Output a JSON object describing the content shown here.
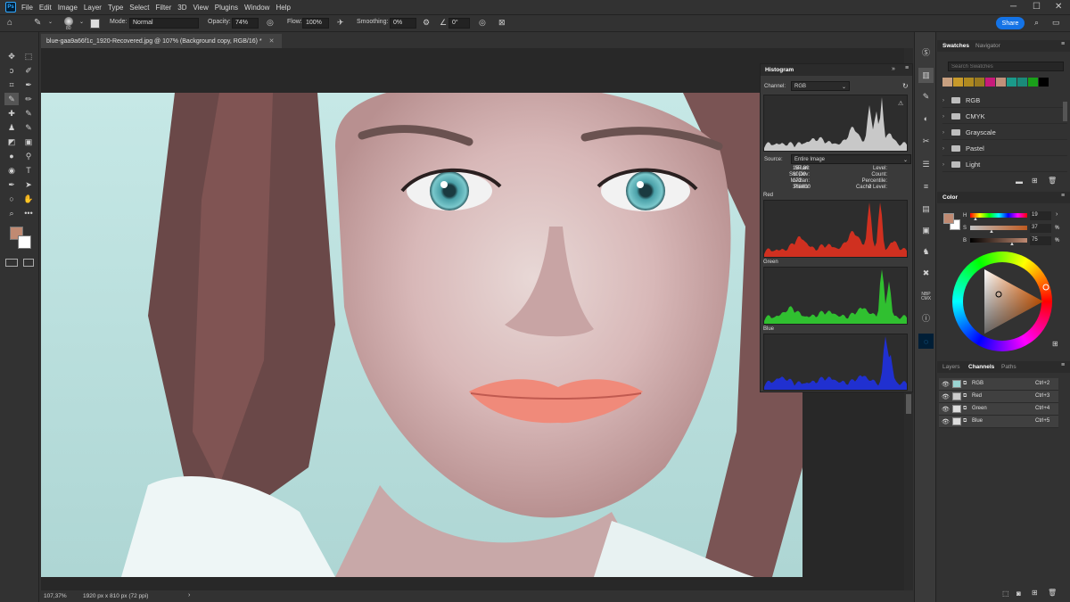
{
  "menu": {
    "app_icon": "Ps",
    "items": [
      "File",
      "Edit",
      "Image",
      "Layer",
      "Type",
      "Select",
      "Filter",
      "3D",
      "View",
      "Plugins",
      "Window",
      "Help"
    ]
  },
  "options": {
    "brush_size": "80",
    "mode_label": "Mode:",
    "mode_value": "Normal",
    "opacity_label": "Opacity:",
    "opacity_value": "74%",
    "flow_label": "Flow:",
    "flow_value": "100%",
    "smoothing_label": "Smoothing:",
    "smoothing_value": "0%",
    "angle_value": "0°",
    "share_label": "Share"
  },
  "document": {
    "tab_title": "blue-gaa9a66f1c_1920-Recovered.jpg @ 107% (Background copy, RGB/16) *",
    "zoom": "107,37%",
    "dimensions": "1920 px x 810 px (72 ppi)"
  },
  "histogram": {
    "title": "Histogram",
    "channel_label": "Channel:",
    "channel_value": "RGB",
    "source_label": "Source:",
    "source_value": "Entire Image",
    "stats_left": [
      {
        "label": "Mean:",
        "value": "157,80"
      },
      {
        "label": "Std Dev:",
        "value": "60,09"
      },
      {
        "label": "Median:",
        "value": "172"
      },
      {
        "label": "Pixels:",
        "value": "388800"
      }
    ],
    "stats_right": [
      {
        "label": "Level:",
        "value": ""
      },
      {
        "label": "Count:",
        "value": ""
      },
      {
        "label": "Percentile:",
        "value": ""
      },
      {
        "label": "Cache Level:",
        "value": "2"
      }
    ],
    "red_label": "Red",
    "green_label": "Green",
    "blue_label": "Blue",
    "colors": {
      "rgb": "#c8c8c8",
      "red": "#d03020",
      "green": "#30c030",
      "blue": "#2030d0"
    }
  },
  "swatches": {
    "tabs": [
      "Swatches",
      "Navigator"
    ],
    "search_placeholder": "Search Swatches",
    "recent": [
      "#c8a080",
      "#c89a2a",
      "#b08a20",
      "#9a7a20",
      "#c81a7a",
      "#c0907a",
      "#1a9a8a",
      "#1a8a7a",
      "#1aa01a",
      "#000000"
    ],
    "groups": [
      "RGB",
      "CMYK",
      "Grayscale",
      "Pastel",
      "Light"
    ]
  },
  "color": {
    "title": "Color",
    "h_label": "H",
    "h_value": "19",
    "s_label": "S",
    "s_value": "37",
    "s_unit": "%",
    "b_label": "B",
    "b_value": "75",
    "b_unit": "%",
    "foreground": "#c08a72",
    "background": "#ffffff"
  },
  "layers": {
    "tabs": [
      "Layers",
      "Channels",
      "Paths"
    ],
    "channels": [
      {
        "name": "RGB",
        "shortcut": "Ctrl+2"
      },
      {
        "name": "Red",
        "shortcut": "Ctrl+3"
      },
      {
        "name": "Green",
        "shortcut": "Ctrl+4"
      },
      {
        "name": "Blue",
        "shortcut": "Ctrl+5"
      }
    ]
  }
}
